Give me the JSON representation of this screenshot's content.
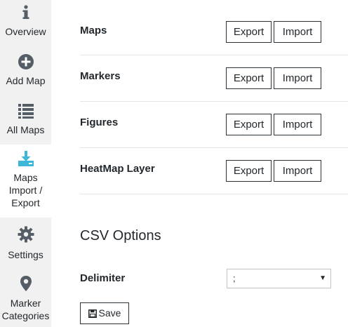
{
  "sidebar": {
    "items": [
      {
        "label": "Overview",
        "icon": "info-icon"
      },
      {
        "label": "Add Map",
        "icon": "plus-circle-icon"
      },
      {
        "label": "All Maps",
        "icon": "list-icon"
      },
      {
        "label_lines": [
          "Maps",
          "Import /",
          "Export"
        ],
        "icon": "download-tray-icon",
        "active": true
      },
      {
        "label": "Settings",
        "icon": "gear-icon"
      },
      {
        "label_lines": [
          "Marker",
          "Categories"
        ],
        "icon": "map-pin-icon"
      }
    ],
    "active_color": "#3eb6d8",
    "icon_color": "#555d66"
  },
  "rows": [
    {
      "label": "Maps",
      "export": "Export",
      "import": "Import"
    },
    {
      "label": "Markers",
      "export": "Export",
      "import": "Import"
    },
    {
      "label": "Figures",
      "export": "Export",
      "import": "Import"
    },
    {
      "label": "HeatMap Layer",
      "export": "Export",
      "import": "Import"
    }
  ],
  "csv_options": {
    "title": "CSV Options",
    "delimiter_label": "Delimiter",
    "delimiter_value": ";",
    "save_label": "Save"
  }
}
